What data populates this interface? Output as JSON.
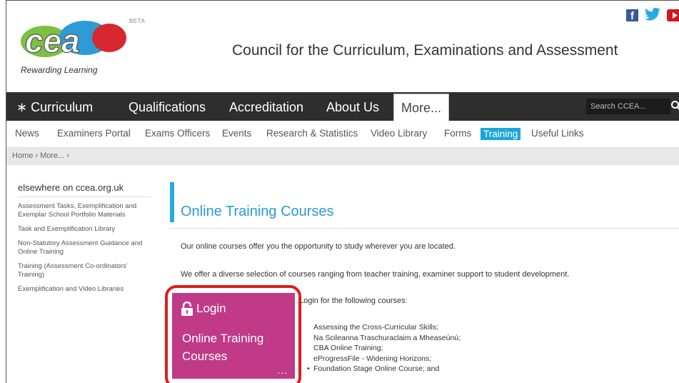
{
  "header": {
    "logo_beta": "BETA",
    "logo_tagline": "Rewarding Learning",
    "org_title": "Council for the Curriculum, Examinations and Assessment",
    "social": {
      "facebook_glyph": "f",
      "facebook_icon": "facebook-icon",
      "twitter_icon": "twitter-icon",
      "youtube_icon": "youtube-icon"
    }
  },
  "main_nav": {
    "items": [
      "∗ Curriculum",
      "Qualifications",
      "Accreditation",
      "About Us",
      "More..."
    ],
    "active": "More...",
    "search_placeholder": "Search CCEA..."
  },
  "sub_nav": {
    "items": [
      "News",
      "Examiners Portal",
      "Exams Officers",
      "Events",
      "Research & Statistics",
      "Video Library",
      "Forms",
      "Training",
      "Useful Links"
    ],
    "active": "Training",
    "active_color": "#1ba6d8"
  },
  "breadcrumb": "Home › More... ›",
  "sidebar": {
    "heading": "elsewhere on ccea.org.uk",
    "links": [
      "Assessment Tasks, Exemplification and Exemplar School Portfolio Materials",
      "Task and Exemplification Library",
      "Non-Statutory Assessment Guidance and Online Training",
      "Training (Assessment Co-ordinators' Training)",
      "Exemplification and Video Libraries"
    ]
  },
  "content": {
    "title": "Online Training Courses",
    "para1": "Our online courses offer you the opportunity to study wherever you are located.",
    "para2": "We offer a diverse selection of courses ranging from teacher training, examiner support to student development.",
    "login_intro": "Login for the following courses:",
    "courses": [
      "Assessing the Cross-Curricular Skills;",
      "Na Scileanna Traschuraclaim a Mheaseúnú;",
      "CBA Online Training;",
      "eProgressFile - Widening Horizons;",
      "Foundation Stage Online Course; and"
    ]
  },
  "login_tile": {
    "label": "Login",
    "line1": "Online Training",
    "line2": "Courses",
    "more": "...",
    "color": "#c03a88",
    "highlight_color": "#e01b1b"
  }
}
